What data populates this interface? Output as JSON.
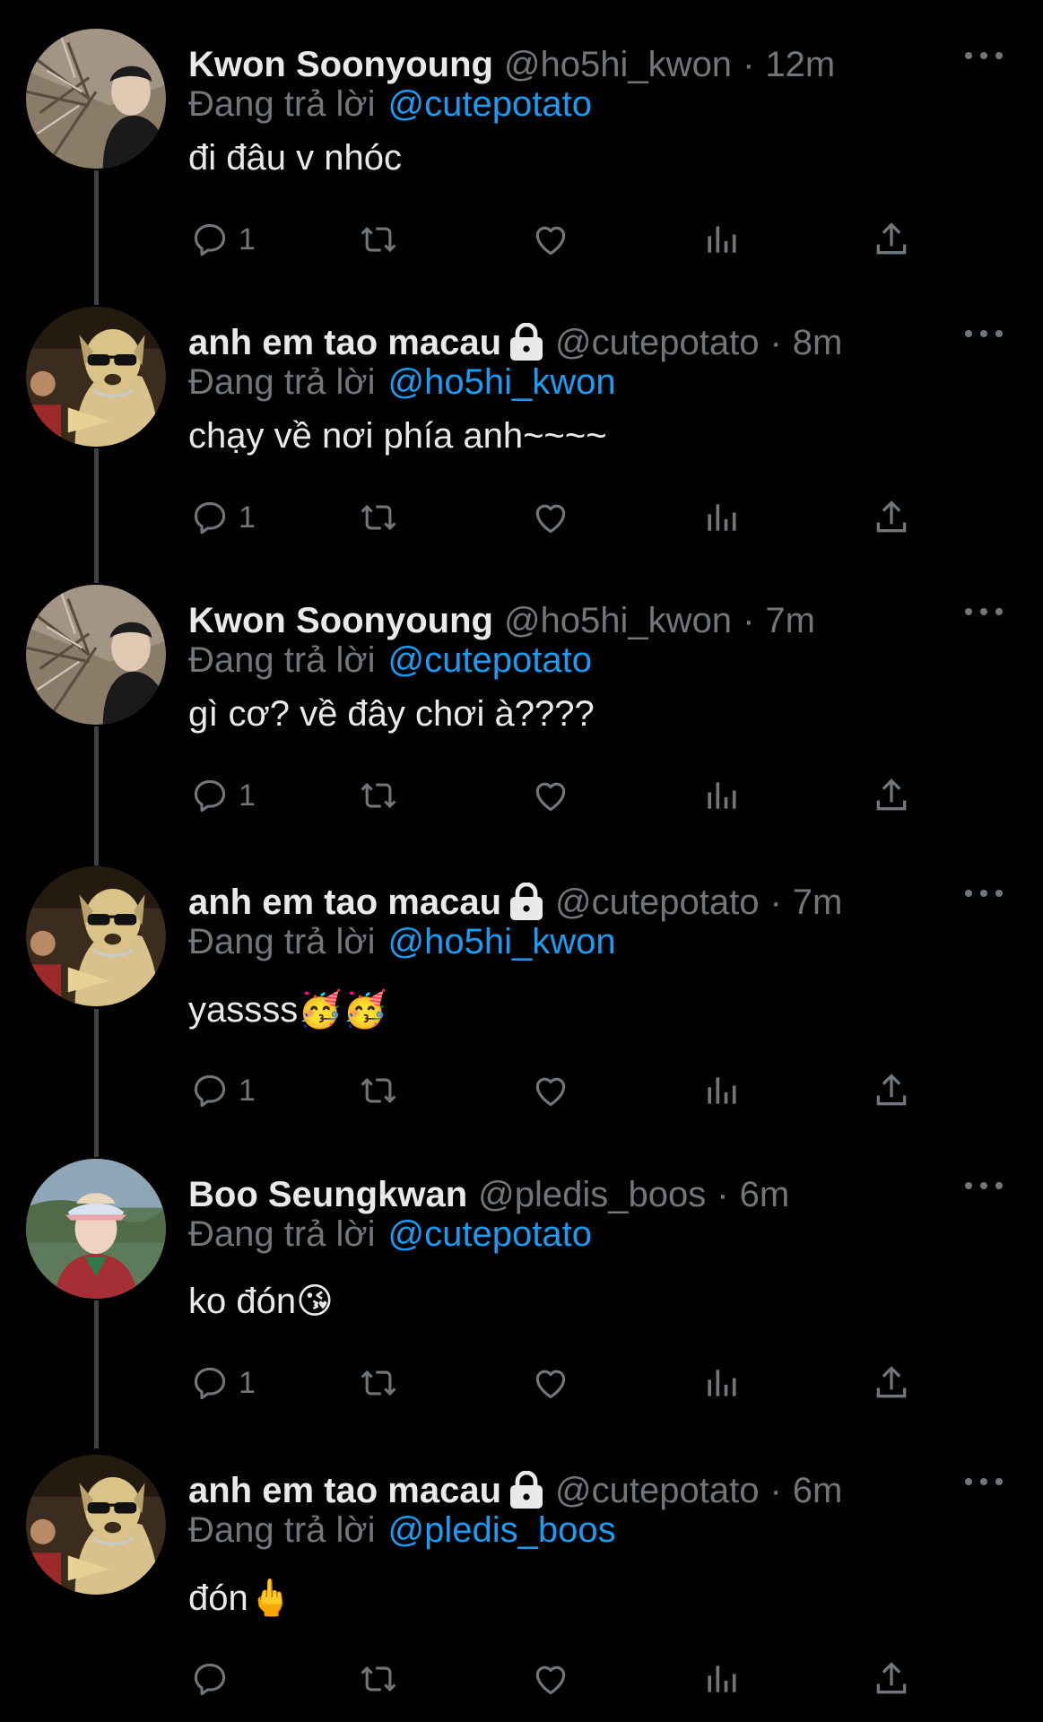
{
  "reply_prefix": "Đang trả lời",
  "colors": {
    "background": "#000000",
    "text": "#e7e9ea",
    "muted": "#71767b",
    "mention": "#1d9bf0",
    "thread_line": "#3d4247"
  },
  "tweets": [
    {
      "name": "Kwon Soonyoung",
      "handle": "@ho5hi_kwon",
      "time": "12m",
      "protected": false,
      "avatar": "forest-portrait",
      "reply_to": "@cutepotato",
      "text": "đi đâu v nhóc",
      "reply_count": "1"
    },
    {
      "name": "anh em tao macau",
      "handle": "@cutepotato",
      "time": "8m",
      "protected": true,
      "avatar": "dog-sunglasses",
      "reply_to": "@ho5hi_kwon",
      "text": "chạy về nơi phía anh~~~~",
      "reply_count": "1"
    },
    {
      "name": "Kwon Soonyoung",
      "handle": "@ho5hi_kwon",
      "time": "7m",
      "protected": false,
      "avatar": "forest-portrait",
      "reply_to": "@cutepotato",
      "text": "gì cơ? về đây chơi à????",
      "reply_count": "1"
    },
    {
      "name": "anh em tao macau",
      "handle": "@cutepotato",
      "time": "7m",
      "protected": true,
      "avatar": "dog-sunglasses",
      "reply_to": "@ho5hi_kwon",
      "text": "yassss🥳🥳",
      "reply_count": "1"
    },
    {
      "name": "Boo Seungkwan",
      "handle": "@pledis_boos",
      "time": "6m",
      "protected": false,
      "avatar": "visor-portrait",
      "reply_to": "@cutepotato",
      "text": "ko đón😘",
      "reply_count": "1"
    },
    {
      "name": "anh em tao macau",
      "handle": "@cutepotato",
      "time": "6m",
      "protected": true,
      "avatar": "dog-sunglasses",
      "reply_to": "@pledis_boos",
      "text": "đón🖕",
      "reply_count": ""
    }
  ]
}
